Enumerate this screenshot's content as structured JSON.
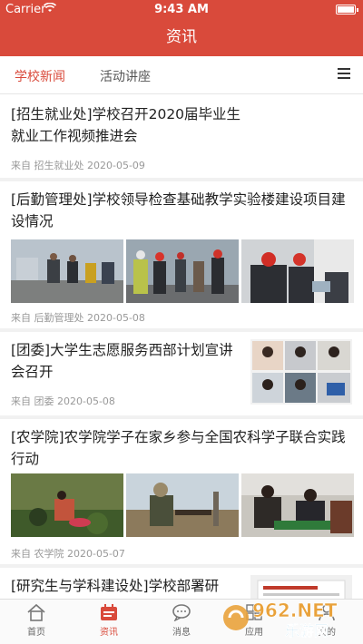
{
  "status": {
    "carrier": "Carrier",
    "time": "9:43 AM"
  },
  "nav": {
    "title": "资讯"
  },
  "tabs": [
    {
      "label": "学校新闻",
      "active": true
    },
    {
      "label": "活动讲座",
      "active": false
    }
  ],
  "news": [
    {
      "title": "[招生就业处]学校召开2020届毕业生就业工作视频推进会",
      "meta": "来自 招生就业处 2020-05-09"
    },
    {
      "title": "[后勤管理处]学校领导检查基础教学实验楼建设项目建设情况",
      "meta": "来自 后勤管理处 2020-05-08"
    },
    {
      "title": "[团委]大学生志愿服务西部计划宣讲会召开",
      "meta": "来自 团委 2020-05-08"
    },
    {
      "title": "[农学院]农学院学子在家乡参与全国农科学子联合实践行动",
      "meta": "来自 农学院 2020-05-07"
    },
    {
      "title": "[研究生与学科建设处]学校部署研",
      "meta": ""
    }
  ],
  "tabbar": [
    {
      "label": "首页",
      "icon": "home-icon",
      "active": false
    },
    {
      "label": "资讯",
      "icon": "news-icon",
      "active": true
    },
    {
      "label": "消息",
      "icon": "chat-icon",
      "active": false
    },
    {
      "label": "应用",
      "icon": "apps-icon",
      "active": false
    },
    {
      "label": "我的",
      "icon": "user-icon",
      "active": false
    }
  ],
  "watermark": {
    "text_top": "962.NET",
    "text_bottom": "乐游网"
  },
  "colors": {
    "primary": "#d94a3b",
    "meta": "#999999",
    "divider": "#f1f1f1"
  }
}
